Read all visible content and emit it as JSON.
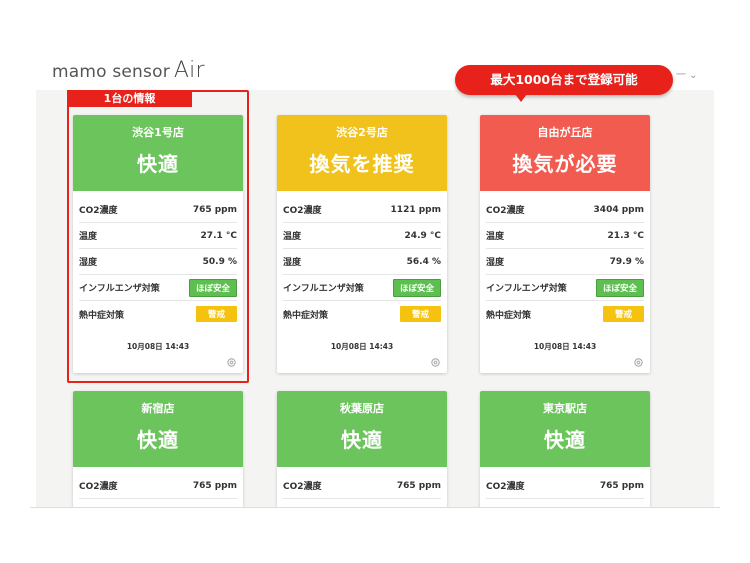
{
  "header": {
    "logo_text": "mamo sensor",
    "logo_air": "Air",
    "menu_stub": "一 ⌄"
  },
  "callout": {
    "text": "最大1000台まで登録可能"
  },
  "highlight": {
    "label": "1台の情報"
  },
  "labels": {
    "co2": "CO2濃度",
    "temp": "温度",
    "humidity": "湿度",
    "influenza": "インフルエンザ対策",
    "heatstroke": "熱中症対策"
  },
  "cards": [
    {
      "store": "渋谷1号店",
      "status": "快適",
      "color": "#6cc55c",
      "co2": "765 ppm",
      "temp": "27.1 °C",
      "humidity": "50.9 %",
      "influenza": "ほぼ安全",
      "heatstroke": "警戒",
      "timestamp": "10月08日 14:43"
    },
    {
      "store": "渋谷2号店",
      "status": "換気を推奨",
      "color": "#f1c21b",
      "co2": "1121 ppm",
      "temp": "24.9 °C",
      "humidity": "56.4 %",
      "influenza": "ほぼ安全",
      "heatstroke": "警戒",
      "timestamp": "10月08日 14:43"
    },
    {
      "store": "自由が丘店",
      "status": "換気が必要",
      "color": "#f15b50",
      "co2": "3404 ppm",
      "temp": "21.3 °C",
      "humidity": "79.9 %",
      "influenza": "ほぼ安全",
      "heatstroke": "警戒",
      "timestamp": "10月08日 14:43"
    },
    {
      "store": "新宿店",
      "status": "快適",
      "color": "#6cc55c",
      "co2": "765 ppm"
    },
    {
      "store": "秋葉原店",
      "status": "快適",
      "color": "#6cc55c",
      "co2": "765 ppm"
    },
    {
      "store": "東京駅店",
      "status": "快適",
      "color": "#6cc55c",
      "co2": "765 ppm"
    }
  ]
}
